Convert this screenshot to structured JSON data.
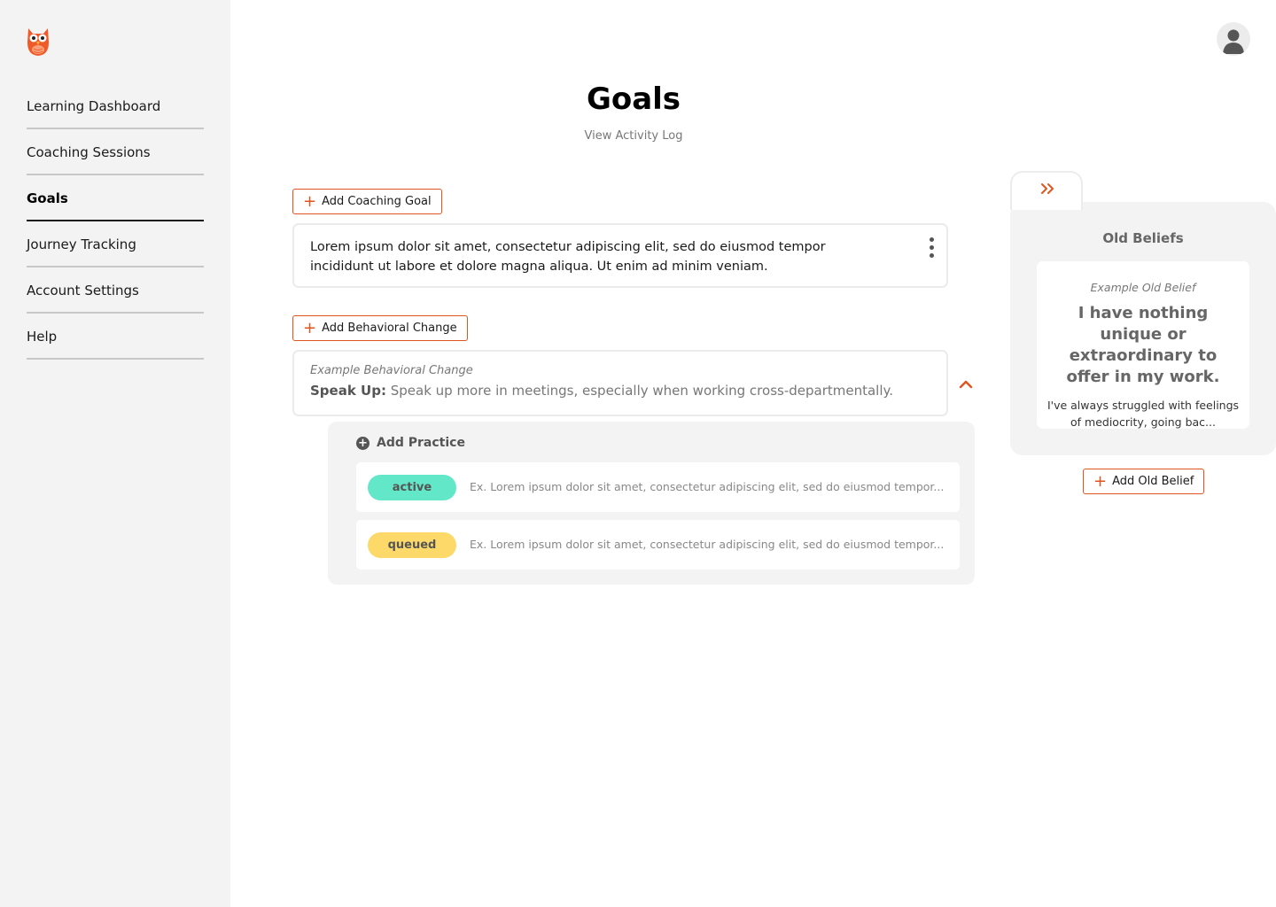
{
  "colors": {
    "accent": "#e0541e",
    "active": "#62e8c8",
    "queued": "#fcd968",
    "sidebar_bg": "#f3f3f3"
  },
  "sidebar": {
    "logo_icon": "owl-logo-icon",
    "items": [
      {
        "label": "Learning Dashboard",
        "active": false
      },
      {
        "label": "Coaching Sessions",
        "active": false
      },
      {
        "label": "Goals",
        "active": true
      },
      {
        "label": "Journey Tracking",
        "active": false
      },
      {
        "label": "Account Settings",
        "active": false
      },
      {
        "label": "Help",
        "active": false
      }
    ]
  },
  "header": {
    "avatar_icon": "user-avatar-icon"
  },
  "page": {
    "title": "Goals",
    "activity_link": "View Activity Log"
  },
  "coaching_goal": {
    "add_label": "Add Coaching Goal",
    "text": "Lorem ipsum dolor sit amet, consectetur adipiscing elit, sed do eiusmod tempor incididunt ut labore et dolore magna aliqua. Ut enim ad minim veniam."
  },
  "behavioral_change": {
    "add_label": "Add Behavioral Change",
    "eyebrow": "Example Behavioral Change",
    "name": "Speak Up:",
    "description": "Speak up more in meetings, especially when working cross-departmentally."
  },
  "practices": {
    "add_label": "Add Practice",
    "items": [
      {
        "status": "active",
        "text": "Ex. Lorem ipsum dolor sit amet, consectetur adipiscing elit, sed do eiusmod tempor..."
      },
      {
        "status": "queued",
        "text": "Ex. Lorem ipsum dolor sit amet, consectetur adipiscing elit, sed do eiusmod tempor..."
      }
    ]
  },
  "old_beliefs": {
    "title": "Old Beliefs",
    "eyebrow": "Example Old Belief",
    "belief": "I have nothing unique or extraordinary to offer in my work.",
    "description": "I've always struggled with feelings of mediocrity, going bac...",
    "add_label": "Add Old Belief"
  }
}
